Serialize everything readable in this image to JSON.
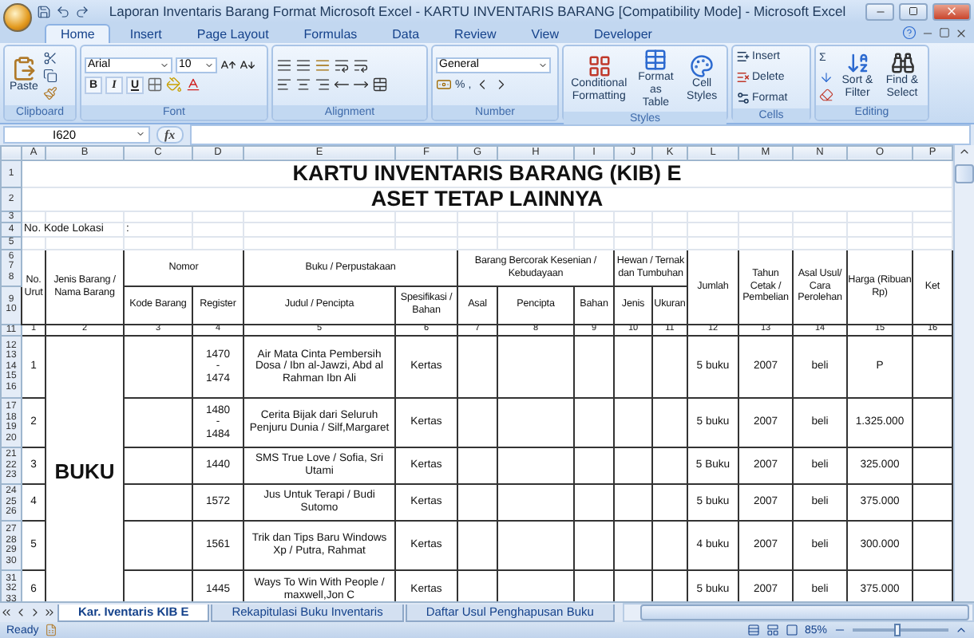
{
  "window": {
    "title": "Laporan Inventaris Barang Format Microsoft Excel - KARTU INVENTARIS BARANG  [Compatibility Mode] - Microsoft Excel"
  },
  "ribbon_tabs": [
    {
      "label": "Home",
      "selected": true
    },
    {
      "label": "Insert",
      "selected": false
    },
    {
      "label": "Page Layout",
      "selected": false
    },
    {
      "label": "Formulas",
      "selected": false
    },
    {
      "label": "Data",
      "selected": false
    },
    {
      "label": "Review",
      "selected": false
    },
    {
      "label": "View",
      "selected": false
    },
    {
      "label": "Developer",
      "selected": false
    }
  ],
  "ribbon": {
    "clipboard": {
      "label": "Clipboard",
      "paste": "Paste"
    },
    "font": {
      "label": "Font",
      "name": "Arial",
      "size": "10",
      "bold": "B",
      "italic": "I",
      "underline": "U"
    },
    "alignment": {
      "label": "Alignment"
    },
    "number": {
      "label": "Number",
      "format": "General",
      "percent": "%",
      "comma": ","
    },
    "styles": {
      "label": "Styles",
      "buttons": [
        "Conditional Formatting",
        "Format as Table",
        "Cell Styles"
      ]
    },
    "cells": {
      "label": "Cells",
      "buttons": [
        "Insert",
        "Delete",
        "Format"
      ]
    },
    "editing": {
      "label": "Editing",
      "sum": "Σ",
      "buttons": [
        "Sort & Filter",
        "Find & Select"
      ]
    }
  },
  "formula_bar": {
    "name_box": "I620",
    "fx": "fx"
  },
  "sheet": {
    "column_headers": [
      "A",
      "B",
      "C",
      "D",
      "E",
      "F",
      "G",
      "H",
      "I",
      "J",
      "K",
      "L",
      "M",
      "N",
      "O",
      "P"
    ],
    "top_rows": [
      {
        "number": "1",
        "kind": "title",
        "text": "KARTU INVENTARIS BARANG (KIB) E"
      },
      {
        "number": "2",
        "kind": "title",
        "text": "ASET TETAP LAINNYA"
      },
      {
        "number": "3",
        "kind": "blank"
      },
      {
        "number": "4",
        "kind": "location",
        "label": "No. Kode Lokasi",
        "value": ":"
      },
      {
        "number": "5",
        "kind": "blank"
      }
    ],
    "header": {
      "top_rows": [
        "6",
        "7",
        "8"
      ],
      "bottom_rows": [
        "9",
        "10"
      ],
      "cells": [
        {
          "label": "No. Urut"
        },
        {
          "label": "Jenis Barang / Nama Barang"
        },
        {
          "label": "Nomor",
          "columns": [
            "Kode Barang",
            "Register"
          ]
        },
        {
          "label": "Buku / Perpustakaan",
          "columns": [
            "Judul / Pencipta",
            "Spesifikasi / Bahan"
          ]
        },
        {
          "label": "Barang Bercorak Kesenian / Kebudayaan",
          "columns": [
            "Asal",
            "Pencipta",
            "Bahan"
          ]
        },
        {
          "label": "Hewan / Ternak dan Tumbuhan",
          "columns": [
            "Jenis",
            "Ukuran"
          ]
        },
        {
          "label": "Jumlah"
        },
        {
          "label": "Tahun Cetak / Pembelian"
        },
        {
          "label": "Asal Usul/ Cara Perolehan"
        },
        {
          "label": "Harga (Ribuan Rp)"
        },
        {
          "label": "Ket"
        }
      ]
    },
    "index_row": {
      "number": "11",
      "values": [
        "1",
        "2",
        "3",
        "4",
        "5",
        "6",
        "7",
        "8",
        "9",
        "10",
        "11",
        "12",
        "13",
        "14",
        "15",
        "16"
      ]
    },
    "category": "BUKU",
    "items": [
      {
        "rows": [
          "12",
          "13",
          "14",
          "15",
          "16"
        ],
        "no": "1",
        "register": "1470 - 1474",
        "title": "Air Mata Cinta Pembersih Dosa / Ibn al-Jawzi, Abd al Rahman Ibn Ali",
        "material": "Kertas",
        "quantity": "5 buku",
        "year": "2007",
        "origin": "beli",
        "price": "P"
      },
      {
        "rows": [
          "17",
          "18",
          "19",
          "20"
        ],
        "no": "2",
        "register": "1480 - 1484",
        "title": "Cerita Bijak dari Seluruh Penjuru Dunia / Silf,Margaret",
        "material": "Kertas",
        "quantity": "5 buku",
        "year": "2007",
        "origin": "beli",
        "price": "1.325.000"
      },
      {
        "rows": [
          "21",
          "22",
          "23"
        ],
        "no": "3",
        "register": "1440",
        "title": "SMS True Love / Sofia, Sri Utami",
        "material": "Kertas",
        "quantity": "5 Buku",
        "year": "2007",
        "origin": "beli",
        "price": "325.000"
      },
      {
        "rows": [
          "24",
          "25",
          "26"
        ],
        "no": "4",
        "register": "1572",
        "title": "Jus Untuk Terapi / Budi Sutomo",
        "material": "Kertas",
        "quantity": "5 buku",
        "year": "2007",
        "origin": "beli",
        "price": "375.000"
      },
      {
        "rows": [
          "27",
          "28",
          "29",
          "30"
        ],
        "no": "5",
        "register": "1561",
        "title": "Trik dan Tips Baru Windows Xp / Putra, Rahmat",
        "material": "Kertas",
        "quantity": "4 buku",
        "year": "2007",
        "origin": "beli",
        "price": "300.000"
      },
      {
        "rows": [
          "31",
          "32",
          "33"
        ],
        "no": "6",
        "register": "1445",
        "title": "Ways To Win With People / maxwell,Jon C",
        "material": "Kertas",
        "quantity": "5 buku",
        "year": "2007",
        "origin": "beli",
        "price": "375.000"
      }
    ]
  },
  "sheet_tabs": [
    {
      "label": "Kar. Iventaris KIB E",
      "selected": true
    },
    {
      "label": "Rekapitulasi Buku Inventaris",
      "selected": false
    },
    {
      "label": "Daftar Usul Penghapusan Buku",
      "selected": false
    }
  ],
  "status_bar": {
    "text": "Ready",
    "zoom": "85%",
    "zoom_slider": {
      "level": 0.47
    }
  }
}
